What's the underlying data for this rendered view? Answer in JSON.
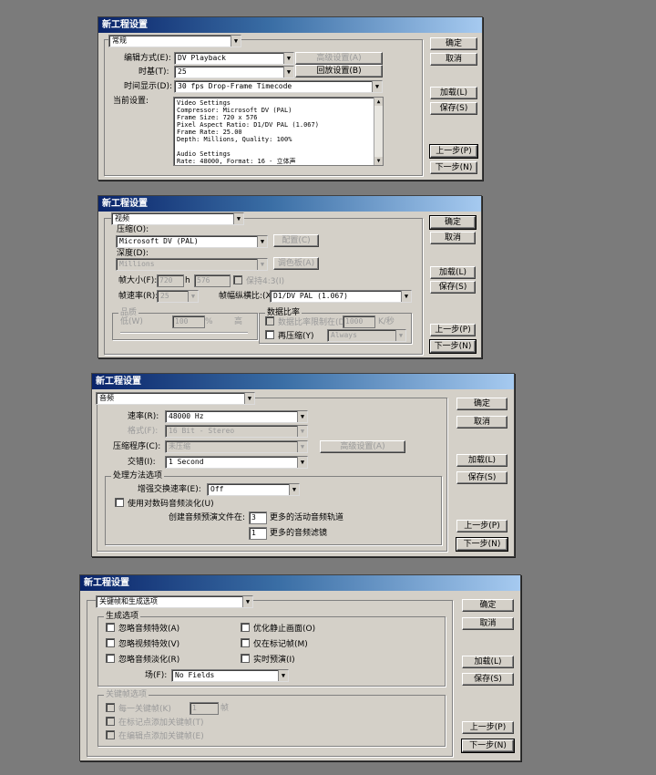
{
  "dialogs": [
    {
      "title": "新工程设置",
      "section": "常规",
      "editing_mode_label": "编辑方式(E):",
      "editing_mode_value": "DV Playback",
      "timebase_label": "时基(T):",
      "timebase_value": "25",
      "time_display_label": "时间显示(D):",
      "time_display_value": "30 fps Drop-Frame Timecode",
      "advanced_settings": "高级设置(A)",
      "playback_settings": "回放设置(B)",
      "current_settings_label": "当前设置:",
      "current_settings_lines": [
        "Video Settings",
        "Compressor: Microsoft DV (PAL)",
        "Frame Size: 720 x 576",
        "Pixel Aspect Ratio: D1/DV PAL (1.067)",
        "Frame Rate: 25.00",
        "Depth: Millions, Quality: 100%",
        "",
        "Audio Settings",
        "Rate: 48000, Format: 16 - 立体声"
      ],
      "ok": "确定",
      "cancel": "取消",
      "load": "加载(L)",
      "save": "保存(S)",
      "prev": "上一步(P)",
      "next": "下一步(N)"
    },
    {
      "title": "新工程设置",
      "section": "视频",
      "compressor_label": "压缩(O):",
      "compressor_value": "Microsoft DV (PAL)",
      "configure": "配置(C)",
      "depth_label": "深度(D):",
      "depth_value": "Millions",
      "palette": "调色板(A)",
      "frame_size_label": "帧大小(F):",
      "frame_w": "720",
      "h_label": "h",
      "frame_h": "576",
      "keep_43": "保持4:3(I)",
      "frame_rate_label": "帧速率(R):",
      "frame_rate_value": "25",
      "pixel_aspect_label": "帧幅纵横比:(X)",
      "pixel_aspect_value": "D1/DV PAL (1.067)",
      "quality_group": "品质",
      "quality_low": "低(W)",
      "quality_value": "100",
      "quality_pct": "%",
      "quality_high": "高",
      "data_rate_group": "数据比率",
      "limit_data_rate": "数据比率限制在(D)",
      "data_rate_value": "1000",
      "data_rate_unit": "K/秒",
      "recompress": "再压缩(Y)",
      "recompress_value": "Always",
      "ok": "确定",
      "cancel": "取消",
      "load": "加载(L)",
      "save": "保存(S)",
      "prev": "上一步(P)",
      "next": "下一步(N)"
    },
    {
      "title": "新工程设置",
      "section": "音频",
      "rate_label": "速率(R):",
      "rate_value": "48000 Hz",
      "format_label": "格式(F):",
      "format_value": "16 Bit - Stereo",
      "compressor_label": "压缩程序(C):",
      "compressor_value": "未压缩",
      "advanced_settings": "高级设置(A)",
      "interleave_label": "交错(I):",
      "interleave_value": "1 Second",
      "processing_group": "处理方法选项",
      "enhance_rate_label": "增强交换速率(E):",
      "enhance_rate_value": "Off",
      "logarithmic_fades": "使用对数码音频淡化(U)",
      "create_preview_label": "创建音频预演文件在:",
      "active_tracks_value": "3",
      "active_tracks_label": "更多的活动音频轨道",
      "filters_value": "1",
      "filters_label": "更多的音频滤镜",
      "ok": "确定",
      "cancel": "取消",
      "load": "加载(L)",
      "save": "保存(S)",
      "prev": "上一步(P)",
      "next": "下一步(N)"
    },
    {
      "title": "新工程设置",
      "section": "关键帧和生成选项",
      "render_group": "生成选项",
      "ignore_audio_effects": "忽略音频特效(A)",
      "ignore_video_effects": "忽略视频特效(V)",
      "ignore_audio_fades": "忽略音频淡化(R)",
      "optimize_stills": "优化静止画面(O)",
      "frames_only_at_markers": "仅在标记帧(M)",
      "realtime_preview": "实时预演(I)",
      "fields_label": "场(F):",
      "fields_value": "No Fields",
      "keyframe_group": "关键帧选项",
      "keyframe_every": "每一关键帧(K)",
      "keyframe_every_value": "1",
      "keyframe_frames_unit": "帧",
      "add_at_markers": "在标记点添加关键帧(T)",
      "add_at_edits": "在编辑点添加关键帧(E)",
      "ok": "确定",
      "cancel": "取消",
      "load": "加载(L)",
      "save": "保存(S)",
      "prev": "上一步(P)",
      "next": "下一步(N)"
    }
  ]
}
